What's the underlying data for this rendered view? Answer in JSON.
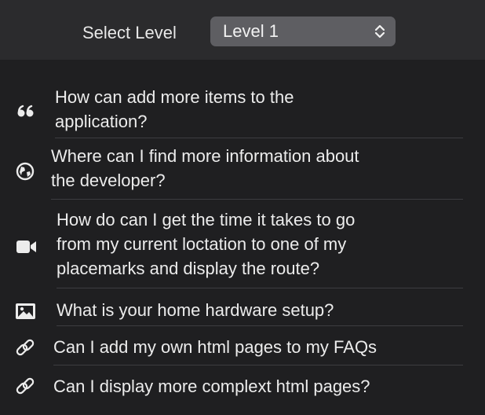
{
  "header": {
    "select_label": "Select Level",
    "level_popup": {
      "selected": "Level 1"
    }
  },
  "faq_items": [
    {
      "icon": "quote-icon",
      "text": "How can add more items to the\napplication?"
    },
    {
      "icon": "globe-icon",
      "text": "Where can I find more information about\nthe developer?"
    },
    {
      "icon": "video-camera-icon",
      "text": "How do can I get the time it takes to go\nfrom my current loctation to one of my\nplacemarks and display the route?"
    },
    {
      "icon": "photo-icon",
      "text": "What is your home hardware setup?"
    },
    {
      "icon": "link-icon",
      "text": "Can I add my own html pages to my FAQs"
    },
    {
      "icon": "link-icon",
      "text": "Can I display more complext html pages?"
    }
  ],
  "colors": {
    "background": "#1f1f21",
    "header_background": "#2b2b2d",
    "popup_background": "#5e5e62",
    "text": "#ececec",
    "divider": "#3d3d40"
  }
}
